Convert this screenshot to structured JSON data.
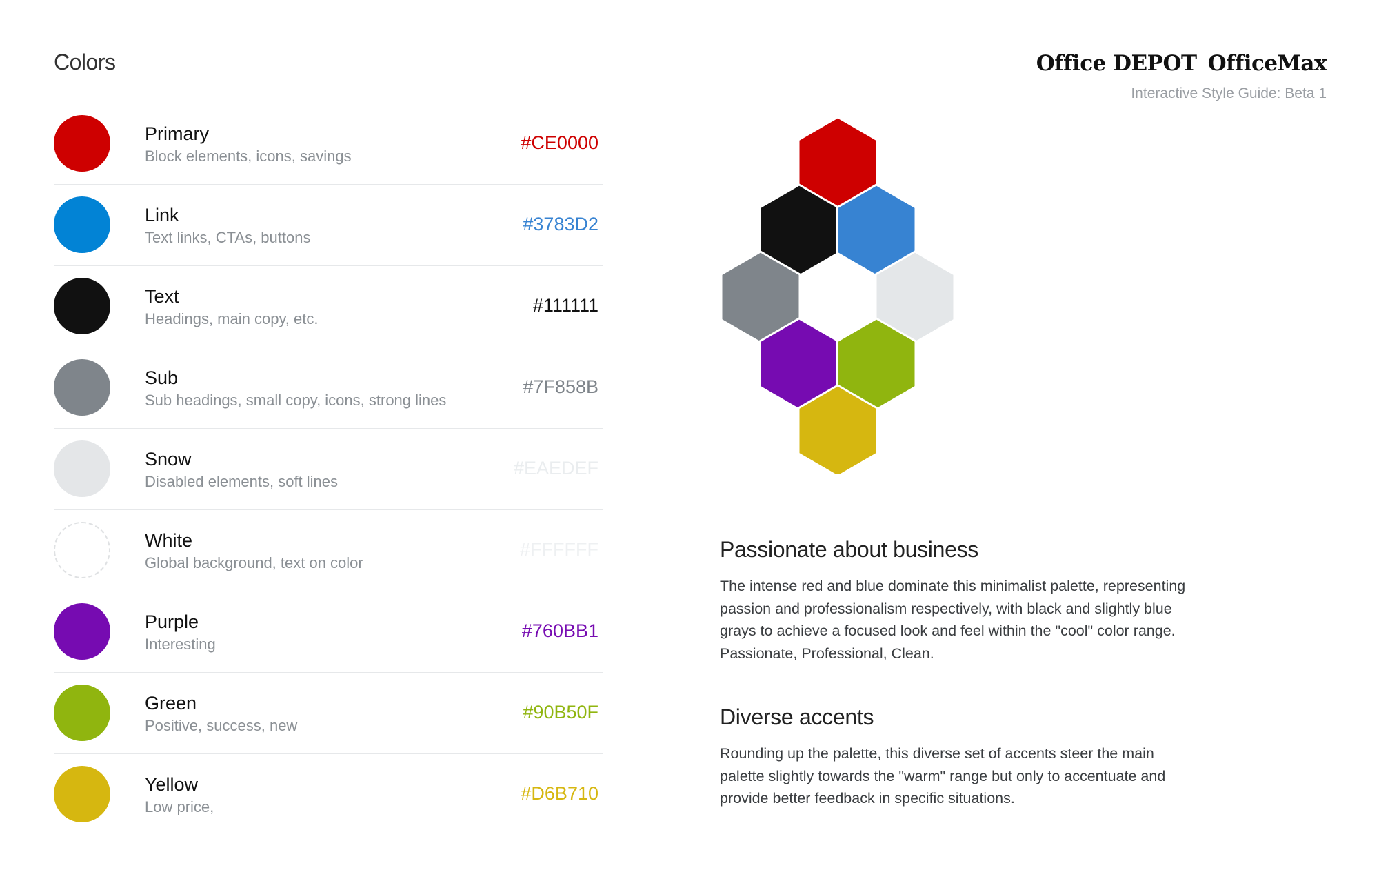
{
  "page_title": "Colors",
  "brand": {
    "logo_office_depot_a": "Office",
    "logo_office_depot_b": "DEPOT",
    "logo_officemax": "OfficeMax",
    "subtitle": "Interactive Style Guide: Beta 1"
  },
  "colors": [
    {
      "name": "Primary",
      "description": "Block elements, icons, savings",
      "hex": "#CE0000",
      "swatch": "#CE0000",
      "hex_text_color": "#CE0000"
    },
    {
      "name": "Link",
      "description": "Text links, CTAs, buttons",
      "hex": "#3783D2",
      "swatch": "#0283D5",
      "hex_text_color": "#3783D2"
    },
    {
      "name": "Text",
      "description": "Headings, main copy, etc.",
      "hex": "#111111",
      "swatch": "#111111",
      "hex_text_color": "#111111"
    },
    {
      "name": "Sub",
      "description": "Sub headings, small copy, icons, strong lines",
      "hex": "#7F858B",
      "swatch": "#7F858B",
      "hex_text_color": "#7F858B"
    },
    {
      "name": "Snow",
      "description": "Disabled elements, soft lines",
      "hex": "#EAEDEF",
      "swatch": "#E4E6E8",
      "hex_text_color": "#EAEDEF"
    },
    {
      "name": "White",
      "description": "Global background, text on color",
      "hex": "#FFFFFF",
      "swatch": "#FFFFFF",
      "hex_text_color": "#EEF0F2"
    },
    {
      "name": "Purple",
      "description": "Interesting",
      "hex": "#760BB1",
      "swatch": "#760BB1",
      "hex_text_color": "#760BB1"
    },
    {
      "name": "Green",
      "description": "Positive, success, new",
      "hex": "#90B50F",
      "swatch": "#90B50F",
      "hex_text_color": "#90B50F"
    },
    {
      "name": "Yellow",
      "description": "Low price,",
      "hex": "#D6B710",
      "swatch": "#D6B710",
      "hex_text_color": "#D6B710"
    }
  ],
  "hex_cluster_colors": {
    "red": "#CE0000",
    "black": "#111111",
    "blue": "#3783D2",
    "gray": "#7F858B",
    "snow": "#E4E7E9",
    "purple": "#760BB1",
    "green": "#90B50F",
    "yellow": "#D6B710"
  },
  "sections": [
    {
      "heading": "Passionate about business",
      "body": "The intense red and blue dominate this minimalist palette, representing passion and professionalism respectively, with black and slightly blue grays to achieve a focused look and feel within the \"cool\" color range. Passionate, Professional, Clean."
    },
    {
      "heading": "Diverse accents",
      "body": "Rounding up the palette, this diverse set of accents steer the main palette slightly towards the \"warm\" range but only to accentuate and provide better feedback in specific situations."
    }
  ]
}
